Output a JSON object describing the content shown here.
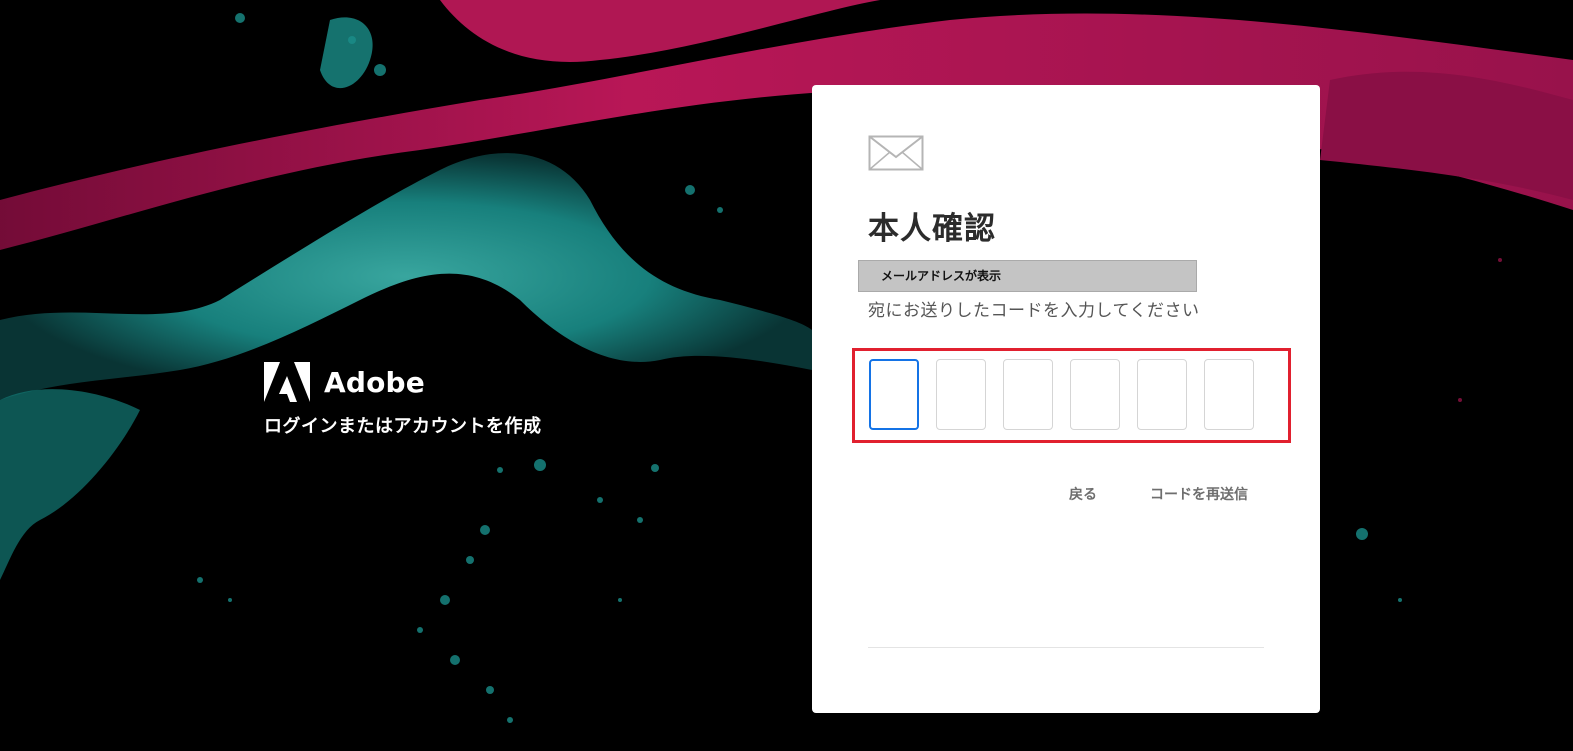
{
  "brand": {
    "name": "Adobe",
    "tagline": "ログインまたはアカウントを作成"
  },
  "card": {
    "icon": "mail-icon",
    "title": "本人確認",
    "email_mask": "メールアドレスが表示",
    "instruction": "宛にお送りしたコードを入力してください",
    "code_length": 6,
    "code_values": [
      "",
      "",
      "",
      "",
      "",
      ""
    ],
    "back_label": "戻る",
    "resend_label": "コードを再送信"
  },
  "colors": {
    "highlight": "#e1202f",
    "focus": "#1473e6",
    "magenta": "#c2185b",
    "teal": "#1a8e8a"
  }
}
